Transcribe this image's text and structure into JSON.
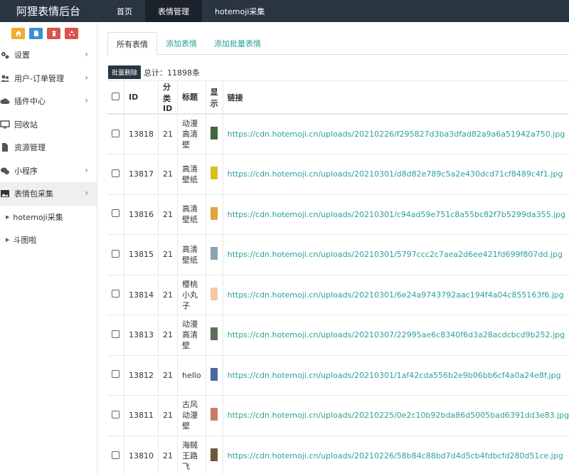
{
  "header": {
    "brand": "阿狸表情后台",
    "nav": [
      {
        "label": "首页",
        "active": false
      },
      {
        "label": "表情管理",
        "active": true
      },
      {
        "label": "hotemoji采集",
        "active": false
      }
    ]
  },
  "sidebar": {
    "quick_buttons": [
      {
        "icon": "home-icon",
        "color": "#f0ad2e"
      },
      {
        "icon": "file-icon",
        "color": "#3a8fd9"
      },
      {
        "icon": "trash-icon",
        "color": "#d9534f"
      },
      {
        "icon": "recycle-icon",
        "color": "#d9534f"
      }
    ],
    "items": [
      {
        "label": "设置",
        "icon": "gears-icon",
        "arrow": true
      },
      {
        "label": "用户-订单管理",
        "icon": "users-icon",
        "arrow": true
      },
      {
        "label": "插件中心",
        "icon": "cloud-icon",
        "arrow": true
      },
      {
        "label": "回收站",
        "icon": "monitor-icon",
        "arrow": false
      },
      {
        "label": "资源管理",
        "icon": "document-icon",
        "arrow": false
      },
      {
        "label": "小程序",
        "icon": "wechat-icon",
        "arrow": true
      },
      {
        "label": "表情包采集",
        "icon": "image-icon",
        "arrow": true,
        "active": true
      }
    ],
    "subitems": [
      {
        "label": "hotemoji采集"
      },
      {
        "label": "斗图啦"
      }
    ]
  },
  "tabs": [
    {
      "label": "所有表情",
      "active": true
    },
    {
      "label": "添加表情",
      "active": false
    },
    {
      "label": "添加批量表情",
      "active": false
    }
  ],
  "toolbar": {
    "batch_delete": "批量删除",
    "total": "总计：11898条"
  },
  "table": {
    "headers": {
      "id": "ID",
      "cat": "分类ID",
      "title": "标题",
      "show": "显示",
      "link": "链接"
    },
    "rows": [
      {
        "id": "13818",
        "cat": "21",
        "title": "动漫高清壁",
        "thumb": "#3d6b3a",
        "link": "https://cdn.hotemoji.cn/uploads/20210226/f295827d3ba3dfad82a9a6a51942a750.jpg"
      },
      {
        "id": "13817",
        "cat": "21",
        "title": "高清壁纸",
        "thumb": "#d8c21a",
        "link": "https://cdn.hotemoji.cn/uploads/20210301/d8d82e789c5a2e430dcd71cf8489c4f1.jpg"
      },
      {
        "id": "13816",
        "cat": "21",
        "title": "高清壁纸",
        "thumb": "#e2a43a",
        "link": "https://cdn.hotemoji.cn/uploads/20210301/c94ad59e751c8a55bc82f7b5299da355.jpg"
      },
      {
        "id": "13815",
        "cat": "21",
        "title": "高清壁纸",
        "thumb": "#8aa3b0",
        "link": "https://cdn.hotemoji.cn/uploads/20210301/5797ccc2c7aea2d6ee421fd699f807dd.jpg"
      },
      {
        "id": "13814",
        "cat": "21",
        "title": "樱桃小丸子",
        "thumb": "#f3c9a8",
        "link": "https://cdn.hotemoji.cn/uploads/20210301/6e24a9743792aac194f4a04c855163f6.jpg"
      },
      {
        "id": "13813",
        "cat": "21",
        "title": "动漫高清壁",
        "thumb": "#5a6e5a",
        "link": "https://cdn.hotemoji.cn/uploads/20210307/22995ae6c8340f6d3a28acdcbcd9b252.jpg"
      },
      {
        "id": "13812",
        "cat": "21",
        "title": "hello",
        "thumb": "#4a6aa0",
        "link": "https://cdn.hotemoji.cn/uploads/20210301/1af42cda556b2e9b06bb6cf4a0a24e8f.jpg"
      },
      {
        "id": "13811",
        "cat": "21",
        "title": "古风动漫壁",
        "thumb": "#c97c6a",
        "link": "https://cdn.hotemoji.cn/uploads/20210225/0e2c10b92bda86d5005bad6391dd3e83.jpg"
      },
      {
        "id": "13810",
        "cat": "21",
        "title": "海贼王路飞",
        "thumb": "#6a5a3a",
        "link": "https://cdn.hotemoji.cn/uploads/20210226/58b84c88bd7d4d5cb4fdbcfd280d51ce.jpg"
      }
    ]
  }
}
